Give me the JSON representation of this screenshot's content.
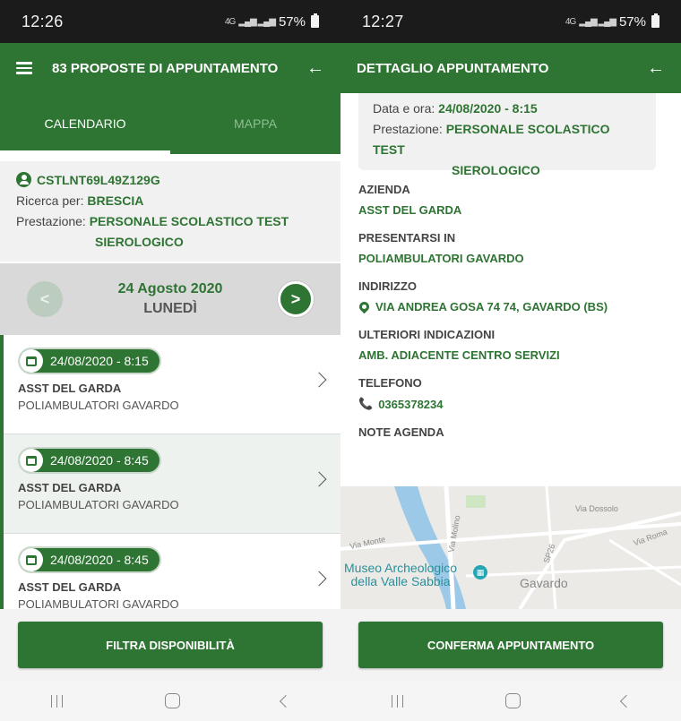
{
  "left": {
    "status": {
      "time": "12:26",
      "network": "4G",
      "battery": "57%"
    },
    "appbar": {
      "title": "83 PROPOSTE DI APPUNTAMENTO",
      "back": "←"
    },
    "tabs": [
      {
        "label": "CALENDARIO",
        "active": true
      },
      {
        "label": "MAPPA",
        "active": false
      }
    ],
    "search": {
      "fiscal_code": "CSTLNT69L49Z129G",
      "search_label": "Ricerca per:",
      "search_value": "BRESCIA",
      "service_label": "Prestazione:",
      "service_line1": "PERSONALE SCOLASTICO TEST",
      "service_line2": "SIEROLOGICO"
    },
    "date_nav": {
      "date": "24 Agosto 2020",
      "weekday": "LUNEDÌ",
      "prev": "<",
      "next": ">"
    },
    "slots": [
      {
        "datetime": "24/08/2020 - 8:15",
        "company": "ASST DEL GARDA",
        "location": "POLIAMBULATORI GAVARDO"
      },
      {
        "datetime": "24/08/2020 - 8:45",
        "company": "ASST DEL GARDA",
        "location": "POLIAMBULATORI GAVARDO"
      },
      {
        "datetime": "24/08/2020 - 8:45",
        "company": "ASST DEL GARDA",
        "location": "POLIAMBULATORI GAVARDO"
      }
    ],
    "button": "FILTRA DISPONIBILITÀ"
  },
  "right": {
    "status": {
      "time": "12:27",
      "network": "4G",
      "battery": "57%"
    },
    "appbar": {
      "title": "DETTAGLIO APPUNTAMENTO",
      "back": "←"
    },
    "summary": {
      "datetime_label": "Data e ora:",
      "datetime_value": "24/08/2020 - 8:15",
      "service_label": "Prestazione:",
      "service_line1": "PERSONALE SCOLASTICO TEST",
      "service_line2": "SIEROLOGICO"
    },
    "fields": {
      "azienda_label": "AZIENDA",
      "azienda_value": "ASST DEL GARDA",
      "presentarsi_label": "PRESENTARSI IN",
      "presentarsi_value": "POLIAMBULATORI GAVARDO",
      "indirizzo_label": "INDIRIZZO",
      "indirizzo_value": "VIA ANDREA GOSA 74 74, GAVARDO (BS)",
      "ulteriori_label": "ULTERIORI INDICAZIONI",
      "ulteriori_value": "AMB. ADIACENTE CENTRO SERVIZI",
      "telefono_label": "TELEFONO",
      "telefono_value": "0365378234",
      "note_label": "NOTE AGENDA"
    },
    "map": {
      "street1": "Via Dossolo",
      "street2": "Via Monte",
      "street3": "Via Molino",
      "street4": "SP26",
      "street5": "Via Roma",
      "poi_line1": "Museo Archeologico",
      "poi_line2": "della Valle Sabbia",
      "town": "Gavardo"
    },
    "button": "CONFERMA APPUNTAMENTO"
  },
  "colors": {
    "primary": "#2e7433",
    "status_bar": "#1b1b1b",
    "panel": "#f1f1f1"
  }
}
